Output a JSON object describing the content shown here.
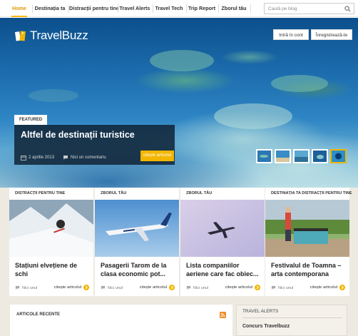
{
  "nav": {
    "items": [
      {
        "label": "Home",
        "active": true
      },
      {
        "label": "Destinația ta"
      },
      {
        "label": "Distracții pentru tine"
      },
      {
        "label": "Travel Alerts"
      },
      {
        "label": "Travel Tech"
      },
      {
        "label": "Trip Report"
      },
      {
        "label": "Zborul tău"
      }
    ],
    "search_placeholder": "Caută pe blog"
  },
  "hero": {
    "logo_text": "TravelBuzz",
    "login_label": "Intră în cont",
    "register_label": "Înregistrează-te",
    "featured_tag": "FEATURED",
    "featured_title": "Altfel de destinații turistice",
    "featured_date": "2 aprilie 2013",
    "featured_comments": "Nici un comentariu",
    "featured_more": "citește articolul",
    "thumbnails": [
      {
        "icon": "island-aerial-thumb-1"
      },
      {
        "icon": "island-aerial-thumb-2"
      },
      {
        "icon": "island-aerial-thumb-3"
      },
      {
        "icon": "island-aerial-thumb-4"
      },
      {
        "icon": "blue-hole-thumb",
        "active": true
      }
    ]
  },
  "cards": [
    {
      "category": "DISTRACȚII PENTRU TINE",
      "title": "Stațiuni elvețiene de schi",
      "comments": "Nici unul",
      "read": "citește articolul",
      "image": "ski-mountain-image"
    },
    {
      "category": "ZBORUL TĂU",
      "title": "Pasagerii Tarom de la clasa economic pot...",
      "comments": "Nici unul",
      "read": "citește articolul",
      "image": "tarom-airplane-image"
    },
    {
      "category": "ZBORUL TĂU",
      "title": "Lista companiilor aeriene care fac obiec...",
      "comments": "Nici unul",
      "read": "citește articolul",
      "image": "airplane-sky-image"
    },
    {
      "category": "DESTINAȚIA TA DISTRACȚII PENTRU TINE",
      "title": "Festivalul de Toamna – arta contemporana",
      "comments": "Nici unul",
      "read": "citește articolul",
      "image": "piano-street-image"
    }
  ],
  "recent": {
    "title": "ARTICOLE RECENTE"
  },
  "alerts": {
    "title": "TRAVEL ALERTS",
    "first_link": "Concurs Travelbuzz"
  },
  "colors": {
    "accent": "#f2b600",
    "dark_overlay": "#0e1e30",
    "page_bg": "#eeeae2"
  }
}
